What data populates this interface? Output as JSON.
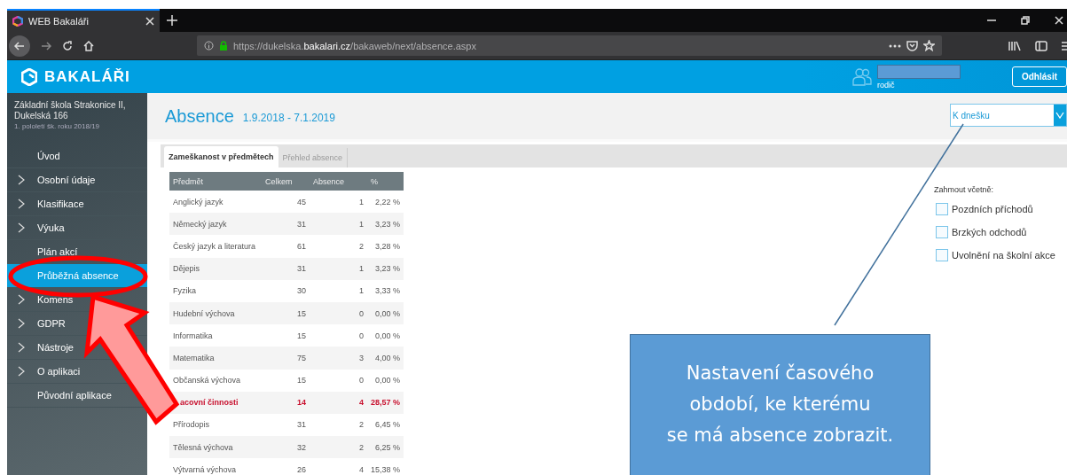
{
  "browser": {
    "tabs": [
      {
        "title": "WEB Bakaláři",
        "selected": true
      }
    ],
    "url": "https://dukelska.**bakalari.cz**/bakaweb/next/absence.aspx"
  },
  "header": {
    "brand": "BAKALÁŘI",
    "user_role": "rodič",
    "logout": "Odhlásit"
  },
  "sidebar": {
    "school": "Základní škola Strakonice II, Dukelská 166",
    "term": "1. pololetí šk. roku 2018/19",
    "items": [
      {
        "label": "Úvod",
        "expandable": false,
        "selected": false
      },
      {
        "label": "Osobní údaje",
        "expandable": true,
        "selected": false
      },
      {
        "label": "Klasifikace",
        "expandable": true,
        "selected": false
      },
      {
        "label": "Výuka",
        "expandable": true,
        "selected": false
      },
      {
        "label": "Plán akcí",
        "expandable": false,
        "selected": false
      },
      {
        "label": "Průběžná absence",
        "expandable": false,
        "selected": true
      },
      {
        "label": "Komens",
        "expandable": true,
        "selected": false
      },
      {
        "label": "GDPR",
        "expandable": true,
        "selected": false
      },
      {
        "label": "Nástroje",
        "expandable": true,
        "selected": false
      },
      {
        "label": "O aplikaci",
        "expandable": true,
        "selected": false
      },
      {
        "label": "Původní aplikace",
        "expandable": false,
        "selected": false
      }
    ]
  },
  "page": {
    "title": "Absence",
    "period": "1.9.2018 - 7.1.2019",
    "period_select": {
      "value": "K dnešku"
    },
    "tabs": [
      {
        "label": "Zameškanost v předmětech",
        "selected": true
      },
      {
        "label": "Přehled absence",
        "selected": false
      }
    ],
    "table": {
      "columns": [
        "Předmět",
        "Celkem",
        "Absence",
        "%"
      ],
      "rows": [
        {
          "cells": [
            "Anglický jazyk",
            "45",
            "1",
            "2,22 %"
          ],
          "highlighted": false
        },
        {
          "cells": [
            "Německý jazyk",
            "31",
            "1",
            "3,23 %"
          ],
          "highlighted": false
        },
        {
          "cells": [
            "Český jazyk a literatura",
            "61",
            "2",
            "3,28 %"
          ],
          "highlighted": false
        },
        {
          "cells": [
            "Dějepis",
            "31",
            "1",
            "3,23 %"
          ],
          "highlighted": false
        },
        {
          "cells": [
            "Fyzika",
            "30",
            "1",
            "3,33 %"
          ],
          "highlighted": false
        },
        {
          "cells": [
            "Hudební výchova",
            "15",
            "0",
            "0,00 %"
          ],
          "highlighted": false
        },
        {
          "cells": [
            "Informatika",
            "15",
            "0",
            "0,00 %"
          ],
          "highlighted": false
        },
        {
          "cells": [
            "Matematika",
            "75",
            "3",
            "4,00 %"
          ],
          "highlighted": false
        },
        {
          "cells": [
            "Občanská výchova",
            "15",
            "0",
            "0,00 %"
          ],
          "highlighted": false
        },
        {
          "cells": [
            "acovní činnosti",
            "14",
            "4",
            "28,57 %"
          ],
          "highlighted": true
        },
        {
          "cells": [
            "Přírodopis",
            "31",
            "2",
            "6,45 %"
          ],
          "highlighted": false
        },
        {
          "cells": [
            "Tělesná výchova",
            "32",
            "2",
            "6,25 %"
          ],
          "highlighted": false
        },
        {
          "cells": [
            "Výtvarná výchova",
            "26",
            "4",
            "15,38 %"
          ],
          "highlighted": false
        }
      ]
    },
    "include": {
      "label": "Zahmout včetně:",
      "options": [
        {
          "label": "Pozdních příchodů",
          "checked": false
        },
        {
          "label": "Brzkých odchodů",
          "checked": false
        },
        {
          "label": "Uvolnění na školní akce",
          "checked": false
        }
      ]
    }
  },
  "annotation": {
    "callout": "Nastavení časového\nobdobí, ke kterému\nse má absence zobrazit."
  }
}
